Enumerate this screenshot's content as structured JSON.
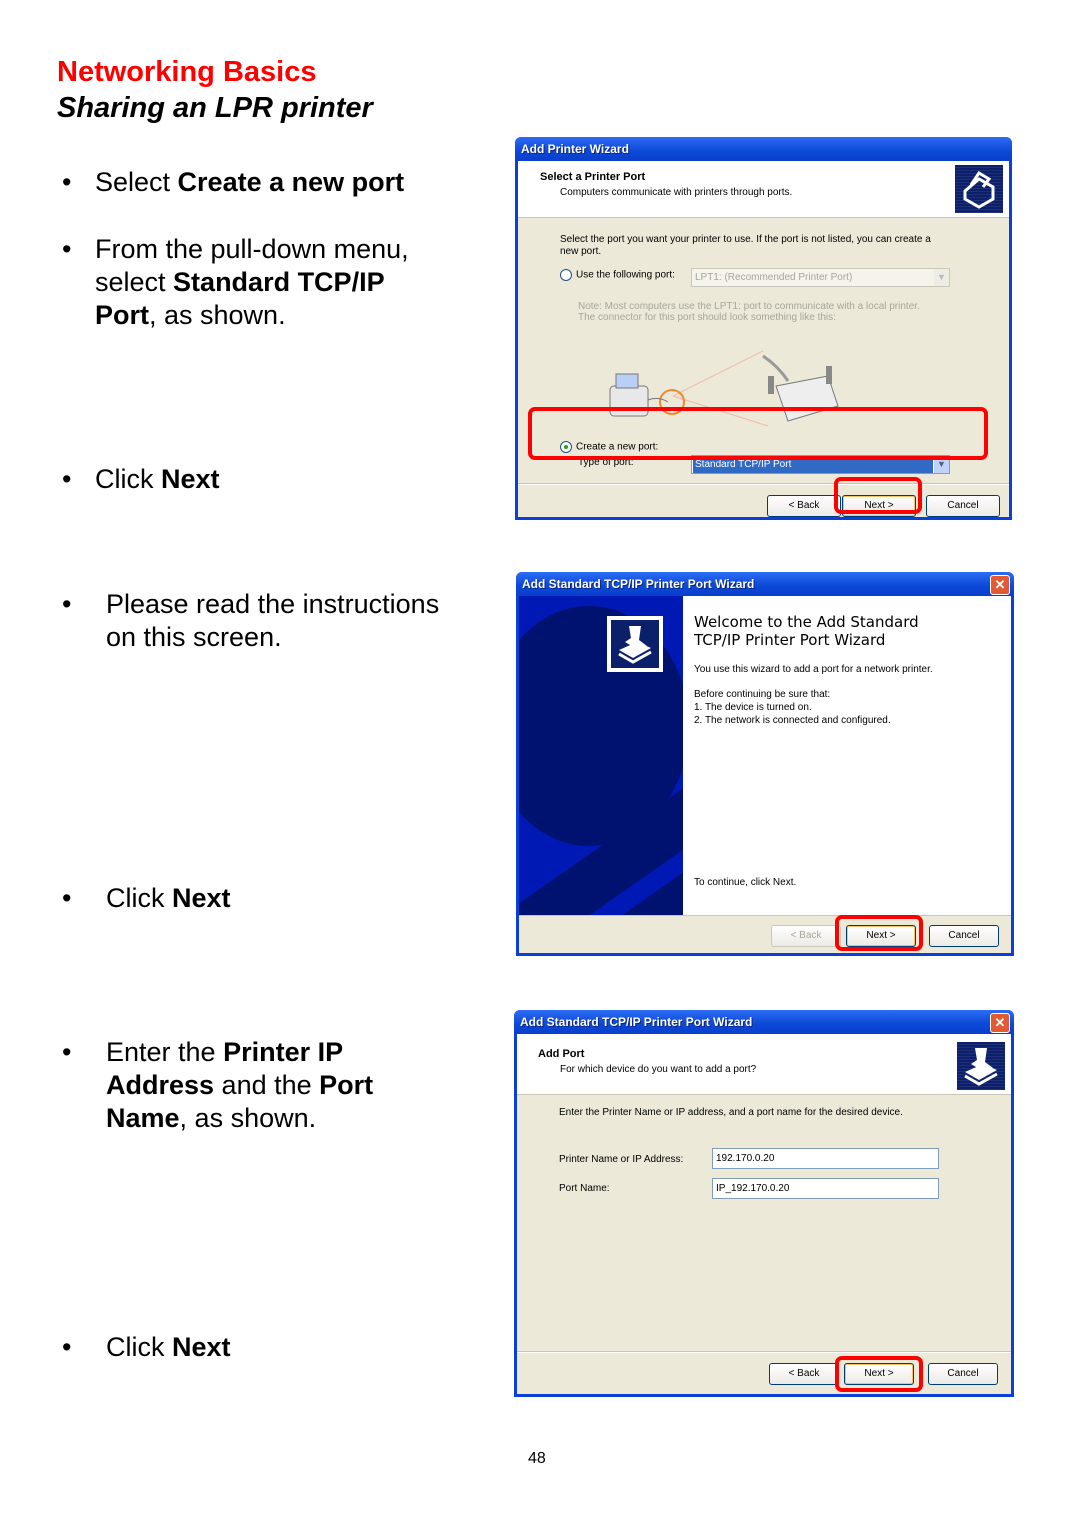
{
  "page": {
    "section_title": "Networking Basics",
    "subtitle": "Sharing an LPR printer",
    "page_number": "48",
    "accent_color": "#ff0000"
  },
  "instructions": [
    {
      "prefix": "Select ",
      "bold": "Create a new port",
      "suffix": ""
    },
    {
      "line1_prefix": "From the pull-down menu,",
      "line2_prefix": "select ",
      "line2_bold": "Standard TCP/IP",
      "line3_bold": "Port",
      "line3_suffix": ", as shown."
    },
    {
      "prefix": "Click ",
      "bold": "Next"
    },
    {
      "line1": "Please read the instructions",
      "line2": "on this screen."
    },
    {
      "prefix": "Click ",
      "bold": "Next"
    },
    {
      "line1_prefix": "Enter the ",
      "line1_bold": "Printer IP",
      "line2_bold": "Address",
      "line2_mid": " and the ",
      "line2_bold2": "Port",
      "line3_bold": "Name",
      "line3_suffix": ", as shown."
    },
    {
      "prefix": "Click ",
      "bold": "Next"
    }
  ],
  "dialog1": {
    "title": "Add Printer Wizard",
    "header_title": "Select a Printer Port",
    "header_subtitle": "Computers communicate with printers through ports.",
    "intro_line1": "Select the port you want your printer to use.  If the port is not listed, you can create a",
    "intro_line2": "new port.",
    "use_port_label": "Use the following port:",
    "use_port_value": "LPT1: (Recommended Printer Port)",
    "note_line1": "Note: Most computers use the LPT1: port to communicate with a local printer.",
    "note_line2": "The connector for this port should look something like this:",
    "create_port_label": "Create a new port:",
    "type_of_port_label": "Type of port:",
    "type_of_port_value": "Standard TCP/IP Port",
    "back_label": "< Back",
    "next_label": "Next >",
    "cancel_label": "Cancel"
  },
  "dialog2": {
    "title": "Add Standard TCP/IP Printer Port Wizard",
    "welcome_line1": "Welcome to the Add Standard",
    "welcome_line2": "TCP/IP Printer Port Wizard",
    "desc": "You use this wizard to add a port for a network printer.",
    "before": "Before continuing be sure that:",
    "item1": "1.  The device is turned on.",
    "item2": "2.  The network is connected and configured.",
    "continue": "To continue, click Next.",
    "back_label": "< Back",
    "next_label": "Next >",
    "cancel_label": "Cancel"
  },
  "dialog3": {
    "title": "Add Standard TCP/IP Printer Port Wizard",
    "header_title": "Add Port",
    "header_subtitle": "For which device do you want to add a port?",
    "intro": "Enter the Printer Name or IP address, and a port name for the desired device.",
    "ip_label": "Printer Name or IP Address:",
    "ip_value": "192.170.0.20",
    "port_label": "Port Name:",
    "port_value": "IP_192.170.0.20",
    "back_label": "< Back",
    "next_label": "Next >",
    "cancel_label": "Cancel"
  }
}
